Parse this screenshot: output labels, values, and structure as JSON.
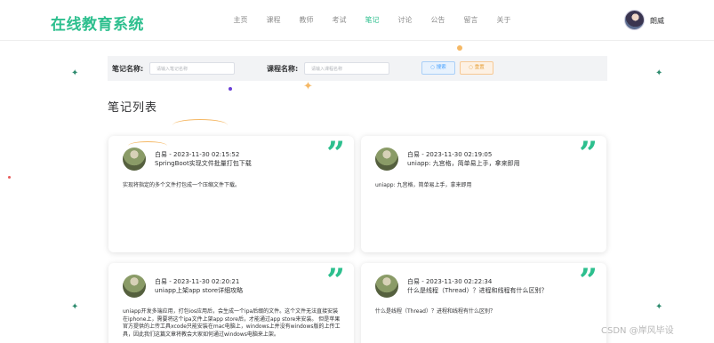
{
  "header": {
    "logo": "在线教育系统",
    "nav": [
      "主页",
      "课程",
      "教师",
      "考试",
      "笔记",
      "讨论",
      "公告",
      "留言",
      "关于"
    ],
    "active_nav_index": 4,
    "username": "朗威"
  },
  "search": {
    "note_label": "笔记名称:",
    "note_placeholder": "请输入笔记名称",
    "course_label": "课程名称:",
    "course_placeholder": "请输入课程名称",
    "search_button": "搜索",
    "reset_button": "重置"
  },
  "section_title": "笔记列表",
  "notes": [
    {
      "meta": "白易 - 2023-11-30 02:15:52",
      "title": "SpringBoot实现文件批量打包下载",
      "content": "实现将指定的多个文件打包成一个压缩文件下载。"
    },
    {
      "meta": "白易 - 2023-11-30 02:19:05",
      "title": "uniapp: 九宫格，简单易上手，拿来即用",
      "content": "uniapp: 九宫格，简单易上手，拿来即用"
    },
    {
      "meta": "白易 - 2023-11-30 02:20:21",
      "title": "uniapp上架app store详细攻略",
      "content": "uniapp开发多端应用，打包ios应用后，会生成一个ipa后缀的文件。这个文件无法直接安装在iphone上，需要将这个ipa文件上架app store后，才能通过app store来安装。 但是苹果官方提供的上传工具xcode只能安装在mac电脑上，windows上并没有windows版的上传工具，因此我们这篇文章将教会大家如何通过windows电脑来上架。"
    },
    {
      "meta": "白易 - 2023-11-30 02:22:34",
      "title": "什么是线程（Thread）？进程和线程有什么区别？",
      "content": "什么是线程（Thread）？进程和线程有什么区别？"
    }
  ],
  "watermark": "CSDN @岸风毕设",
  "colors": {
    "accent": "#2dbf8e",
    "search_button": "#409eff",
    "reset_button": "#e6a23c"
  }
}
